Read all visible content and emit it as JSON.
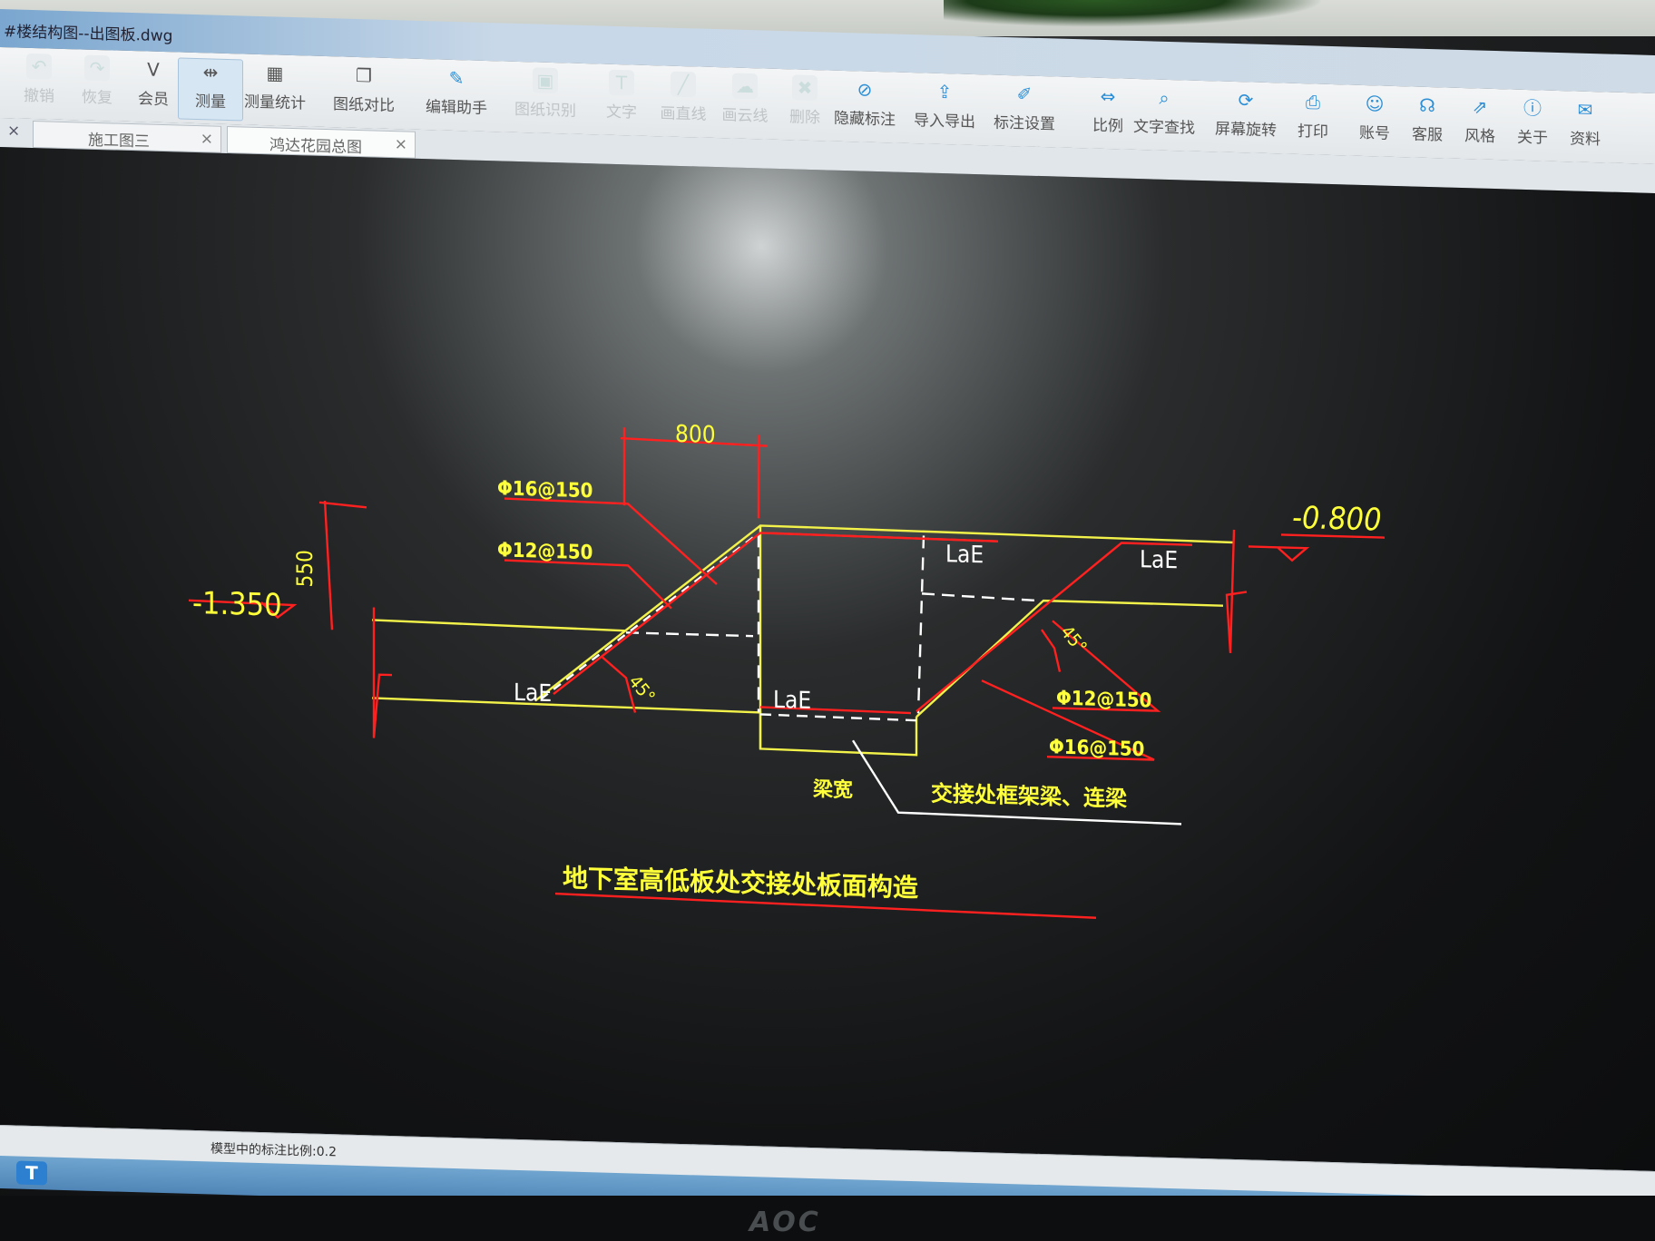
{
  "window": {
    "title": "#楼结构图--出图板.dwg",
    "load_progress": 0.55
  },
  "toolbar": {
    "items": [
      {
        "label": "撤销",
        "icon": "undo-icon",
        "enabled": false
      },
      {
        "label": "恢复",
        "icon": "redo-icon",
        "enabled": false
      },
      {
        "label": "会员",
        "icon": "vip-icon",
        "enabled": true
      },
      {
        "label": "测量",
        "icon": "measure-icon",
        "enabled": true,
        "active": true
      },
      {
        "label": "测量统计",
        "icon": "measure-stats-icon",
        "enabled": true
      },
      {
        "label": "图纸对比",
        "icon": "compare-icon",
        "enabled": true
      },
      {
        "label": "编辑助手",
        "icon": "edit-assistant-icon",
        "enabled": true
      },
      {
        "label": "图纸识别",
        "icon": "recognize-icon",
        "enabled": false
      },
      {
        "label": "文字",
        "icon": "text-icon",
        "enabled": false
      },
      {
        "label": "画直线",
        "icon": "line-icon",
        "enabled": false
      },
      {
        "label": "画云线",
        "icon": "cloud-icon",
        "enabled": false
      },
      {
        "label": "删除",
        "icon": "delete-icon",
        "enabled": false
      },
      {
        "label": "隐藏标注",
        "icon": "hide-annotation-icon",
        "enabled": true
      },
      {
        "label": "导入导出",
        "icon": "import-export-icon",
        "enabled": true
      },
      {
        "label": "标注设置",
        "icon": "annotation-settings-icon",
        "enabled": true
      },
      {
        "label": "比例",
        "icon": "scale-icon",
        "enabled": true
      },
      {
        "label": "文字查找",
        "icon": "text-search-icon",
        "enabled": true
      },
      {
        "label": "屏幕旋转",
        "icon": "rotate-screen-icon",
        "enabled": true
      },
      {
        "label": "打印",
        "icon": "print-icon",
        "enabled": true
      },
      {
        "label": "账号",
        "icon": "account-icon",
        "enabled": true
      },
      {
        "label": "客服",
        "icon": "support-icon",
        "enabled": true
      },
      {
        "label": "风格",
        "icon": "style-icon",
        "enabled": true
      },
      {
        "label": "关于",
        "icon": "about-icon",
        "enabled": true
      },
      {
        "label": "资料",
        "icon": "resources-icon",
        "enabled": true
      }
    ]
  },
  "tabs": [
    {
      "label": "施工图三",
      "close": "×"
    },
    {
      "label": "鸿达花园总图",
      "close": "×"
    }
  ],
  "drawing": {
    "dim_top": "800",
    "dim_side": "550",
    "elev_left": "-1.350",
    "elev_right": "-0.800",
    "rebar_top_left_1": "Φ16@150",
    "rebar_top_left_2": "Φ12@150",
    "rebar_right_1": "Φ12@150",
    "rebar_right_2": "Φ16@150",
    "anchor_left": "LaE",
    "anchor_mid": "LaE",
    "anchor_top_mid": "LaE",
    "anchor_top_right": "LaE",
    "angle_left": "45°",
    "angle_right": "45°",
    "beam_width_label": "梁宽",
    "beam_note": "交接处框架梁、连梁",
    "caption": "地下室高低板处交接处板面构造",
    "colors": {
      "outline": "#f2f24a",
      "rebar": "#ff2020",
      "text": "#ffff3a",
      "dashed": "#ffffff"
    }
  },
  "status": {
    "text": "模型中的标注比例:0.2"
  },
  "taskbar": {
    "start": "T",
    "tray": "▬ ◐ ◑ ▲ ♦ ◉ ♣ ◂ ▭"
  },
  "monitor": {
    "brand": "AOC"
  }
}
